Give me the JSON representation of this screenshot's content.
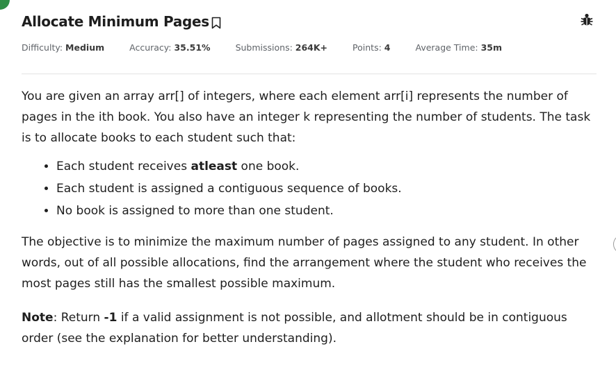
{
  "problem": {
    "title": "Allocate Minimum Pages",
    "difficulty_label": "Difficulty:",
    "difficulty": "Medium",
    "accuracy_label": "Accuracy:",
    "accuracy": "35.51%",
    "submissions_label": "Submissions:",
    "submissions": "264K+",
    "points_label": "Points:",
    "points": "4",
    "avg_time_label": "Average Time:",
    "avg_time": "35m"
  },
  "description": {
    "intro": "You are given an array arr[] of integers, where each element arr[i] represents the number of pages in the ith book. You also have an integer k representing the number of students. The task is to allocate books to each student such that:",
    "bullets": {
      "b1_pre": "Each student receives ",
      "b1_bold": "atleast",
      "b1_post": " one book.",
      "b2": "Each student is assigned a contiguous sequence of books.",
      "b3": "No book is assigned to more than one student."
    },
    "objective": "The objective is to minimize the maximum number of pages assigned to any student. In other words, out of all possible allocations, find the arrangement where the student who receives the most pages still has the smallest possible maximum.",
    "note_label": "Note",
    "note_mid": ": Return ",
    "note_value": "-1",
    "note_post": " if a valid assignment is not possible, and allotment should be in contiguous order (see the explanation for better understanding)."
  },
  "icons": {
    "bookmark": "bookmark-icon",
    "bug": "bug-icon"
  },
  "colors": {
    "accent_green": "#2f8d46",
    "text": "#1e1e1e",
    "meta_text": "#5f6368",
    "divider": "#e3e3e3"
  }
}
